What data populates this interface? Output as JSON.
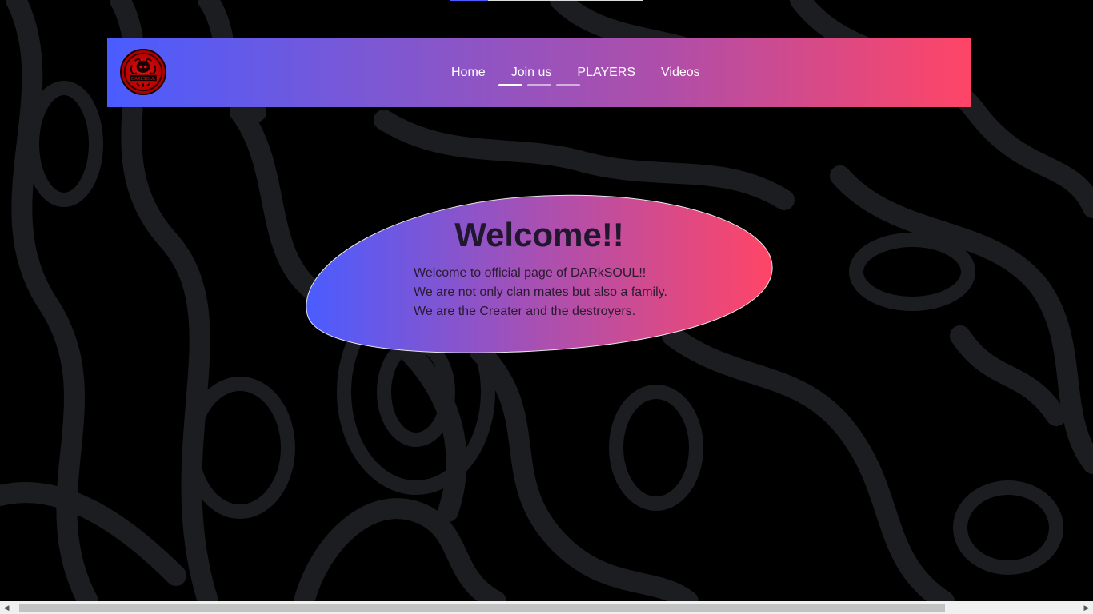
{
  "nav": {
    "links": [
      {
        "label": "Home"
      },
      {
        "label": "Join us"
      },
      {
        "label": "PLAYERS"
      },
      {
        "label": "Videos"
      }
    ]
  },
  "welcome": {
    "title": "Welcome!!",
    "lines": [
      "Welcome to official page of DARkSOUL!!",
      "We are not only clan mates but also a family.",
      "We are the Creater and the destroyers."
    ]
  },
  "colors": {
    "gradient_start": "#4a5cff",
    "gradient_end": "#ff4566",
    "background": "#000000",
    "background_pattern": "#1c1d20",
    "logo": "#e01010"
  },
  "scrollbar": {
    "left_arrow_icon": "triangle-left",
    "right_arrow_icon": "triangle-right"
  }
}
